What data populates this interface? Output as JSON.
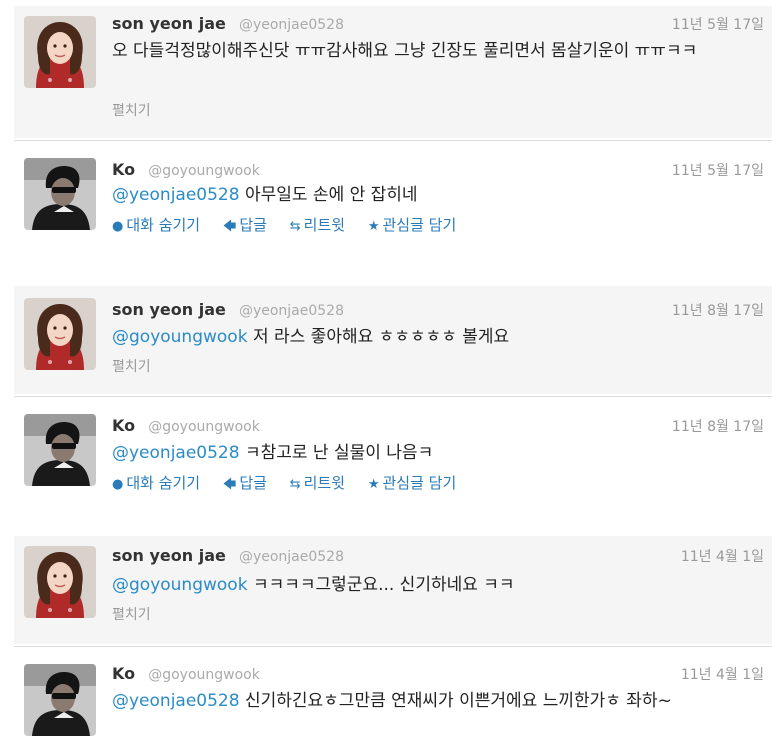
{
  "tweets": [
    {
      "name": "son yeon jae",
      "handle": "@yeonjae0528",
      "time": "11년 5월 17일",
      "mention": "",
      "text": "오 다들걱정많이해주신닷 ㅠㅠ감사해요 그냥 긴장도 풀리면서 몸살기운이 ㅠㅠㅋㅋ",
      "expand": "펼치기",
      "avatar": "woman-avatar"
    },
    {
      "name": "Ko",
      "handle": "@goyoungwook",
      "time": "11년 5월 17일",
      "mention": "@yeonjae0528",
      "text": " 아무일도 손에 안 잡히네",
      "avatar": "man-avatar",
      "actions": {
        "conversation": "대화 숨기기",
        "reply": "답글",
        "retweet": "리트윗",
        "favorite": "관심글 담기"
      }
    },
    {
      "name": "son yeon jae",
      "handle": "@yeonjae0528",
      "time": "11년 8월 17일",
      "mention": "@goyoungwook",
      "text": " 저 라스 좋아해요 ㅎㅎㅎㅎㅎ 볼게요",
      "expand": "펼치기",
      "avatar": "woman-avatar"
    },
    {
      "name": "Ko",
      "handle": "@goyoungwook",
      "time": "11년 8월 17일",
      "mention": "@yeonjae0528",
      "text": " ㅋ참고로 난 실물이 나음ㅋ",
      "avatar": "man-avatar",
      "actions": {
        "conversation": "대화 숨기기",
        "reply": "답글",
        "retweet": "리트윗",
        "favorite": "관심글 담기"
      }
    },
    {
      "name": "son yeon jae",
      "handle": "@yeonjae0528",
      "time": "11년 4월 1일",
      "mention": "@goyoungwook",
      "text": " ㅋㅋㅋㅋ그렇군요... 신기하네요 ㅋㅋ",
      "expand": "펼치기",
      "avatar": "woman-avatar"
    },
    {
      "name": "Ko",
      "handle": "@goyoungwook",
      "time": "11년 4월 1일",
      "mention": "@yeonjae0528",
      "text": " 신기하긴요ㅎ그만큼 연재씨가 이쁜거에요 느끼한가ㅎ 좌하~",
      "avatar": "man-avatar"
    }
  ],
  "icons": {
    "conversation": "speech-bubble-icon",
    "reply": "reply-arrow-icon",
    "retweet": "retweet-icon",
    "favorite": "star-icon"
  },
  "colors": {
    "link": "#2b8bc9",
    "meta": "#999999",
    "panel": "#f5f5f5"
  }
}
